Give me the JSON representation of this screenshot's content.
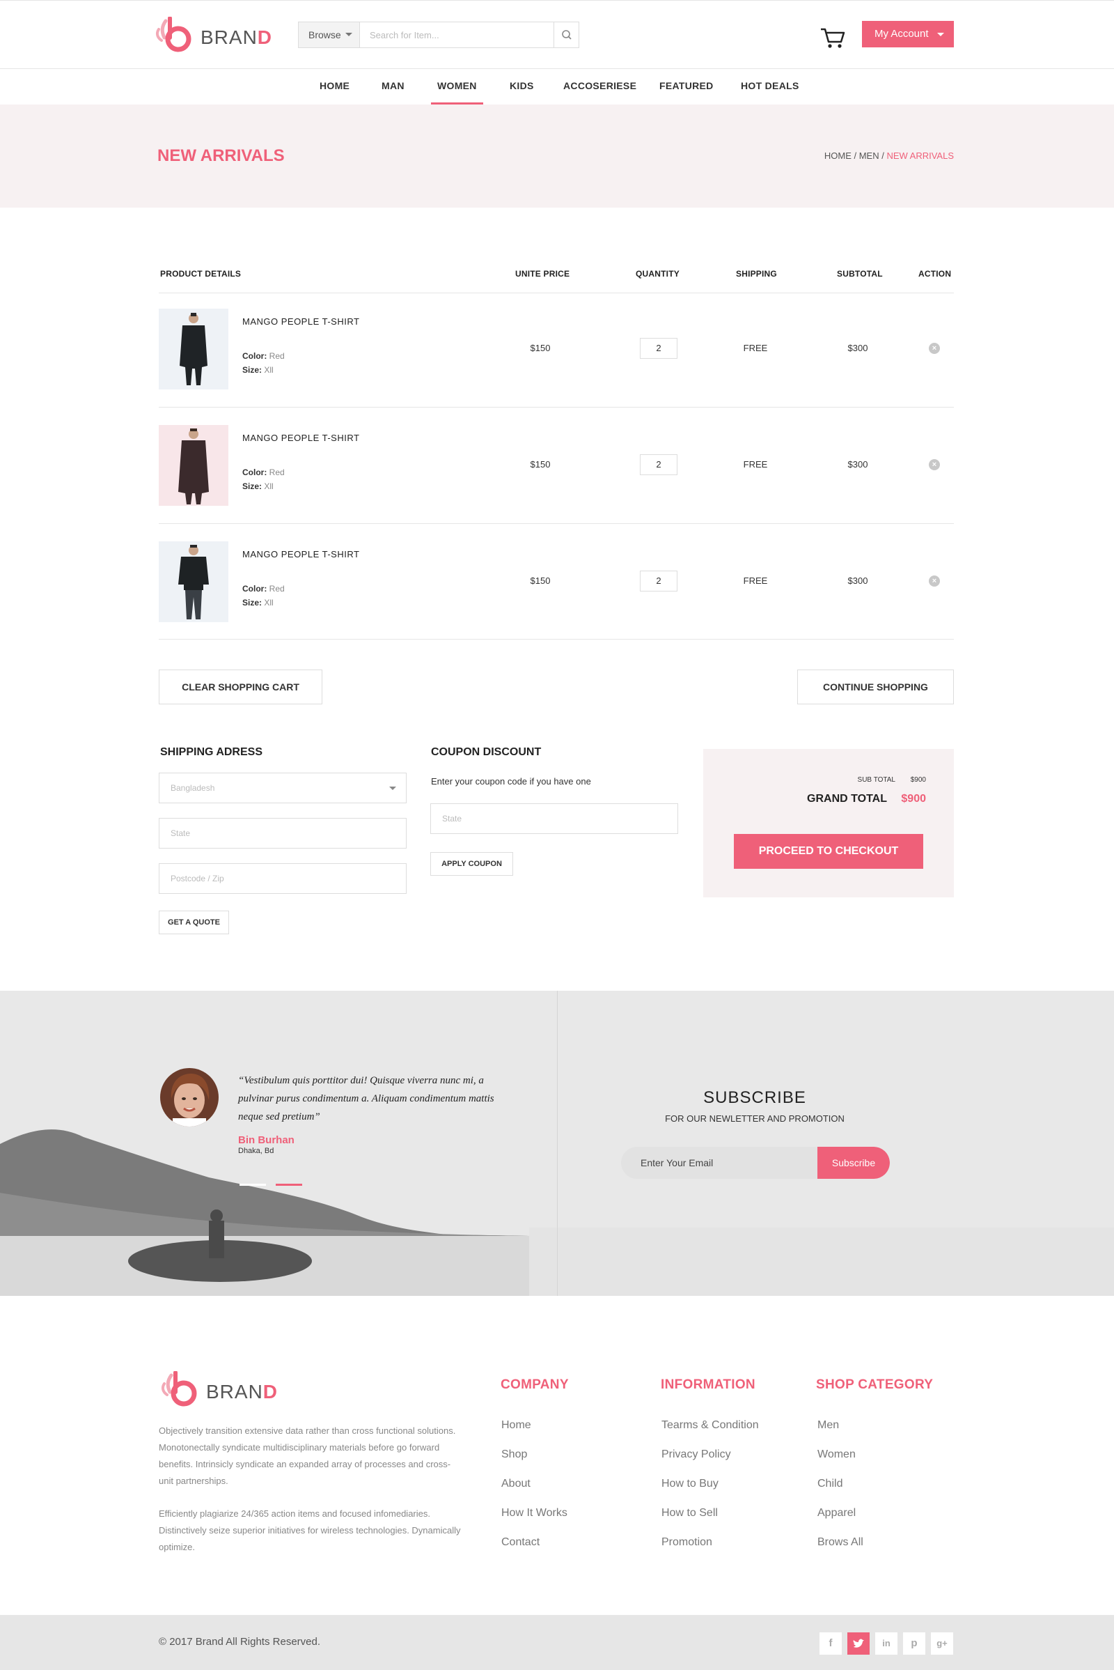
{
  "header": {
    "logo_text": "BRAN",
    "logo_accent": "D",
    "browse_label": "Browse",
    "search_placeholder": "Search for Item...",
    "account_label": "My Account"
  },
  "nav": [
    "HOME",
    "MAN",
    "WOMEN",
    "KIDS",
    "ACCOSERIESE",
    "FEATURED",
    "HOT DEALS"
  ],
  "nav_active": "WOMEN",
  "banner": {
    "title": "NEW ARRIVALS",
    "crumbs": "HOME / MEN / ",
    "crumb_current": "NEW ARRIVALS"
  },
  "cart": {
    "headers": {
      "details": "PRODUCT DETAILS",
      "price": "UNITE PRICE",
      "quantity": "QUANTITY",
      "shipping": "SHIPPING",
      "subtotal": "SUBTOTAL",
      "action": "ACTION"
    },
    "items": [
      {
        "name": "MANGO  PEOPLE  T-SHIRT",
        "color_label": "Color:",
        "color": "Red",
        "size_label": "Size:",
        "size": "Xll",
        "price": "$150",
        "qty": "2",
        "shipping": "FREE",
        "subtotal": "$300"
      },
      {
        "name": "MANGO  PEOPLE  T-SHIRT",
        "color_label": "Color:",
        "color": "Red",
        "size_label": "Size:",
        "size": "Xll",
        "price": "$150",
        "qty": "2",
        "shipping": "FREE",
        "subtotal": "$300"
      },
      {
        "name": "MANGO  PEOPLE  T-SHIRT",
        "color_label": "Color:",
        "color": "Red",
        "size_label": "Size:",
        "size": "Xll",
        "price": "$150",
        "qty": "2",
        "shipping": "FREE",
        "subtotal": "$300"
      }
    ],
    "clear_label": "CLEAR SHOPPING CART",
    "continue_label": "CONTINUE SHOPPING"
  },
  "shipping": {
    "title": "SHIPPING ADRESS",
    "country": "Bangladesh",
    "state_placeholder": "State",
    "zip_placeholder": "Postcode / Zip",
    "quote_label": "GET A QUOTE"
  },
  "coupon": {
    "title": "COUPON  DISCOUNT",
    "hint": "Enter your coupon code if you have one",
    "placeholder": "State",
    "apply_label": "APPLY COUPON"
  },
  "totals": {
    "sub_label": "SUB TOTAL",
    "sub_value": "$900",
    "grand_label": "GRAND TOTAL",
    "grand_value": "$900",
    "checkout_label": "PROCEED TO CHECKOUT"
  },
  "testimonial": {
    "quote": "“Vestibulum quis porttitor dui! Quisque viverra nunc mi, a pulvinar purus condimentum a. Aliquam condimentum mattis neque sed pretium”",
    "name": "Bin Burhan",
    "location": "Dhaka, Bd"
  },
  "subscribe": {
    "title": "SUBSCRIBE",
    "subtitle": "FOR OUR NEWLETTER AND PROMOTION",
    "placeholder": "Enter Your Email",
    "button": "Subscribe"
  },
  "footer": {
    "logo_text": "BRAN",
    "logo_accent": "D",
    "desc1": "Objectively transition extensive data rather than cross functional solutions. Monotonectally syndicate multidisciplinary materials before go forward benefits. Intrinsicly syndicate an expanded array of processes and cross-unit partnerships.",
    "desc2": "Efficiently plagiarize 24/365 action items and focused infomediaries. Distinctively seize superior initiatives for wireless technologies. Dynamically optimize.",
    "company": {
      "title": "COMPANY",
      "links": [
        "Home",
        "Shop",
        "About",
        "How It Works",
        "Contact"
      ]
    },
    "information": {
      "title": "INFORMATION",
      "links": [
        "Tearms & Condition",
        "Privacy Policy",
        "How to Buy",
        "How to Sell",
        "Promotion"
      ]
    },
    "shop": {
      "title": "SHOP CATEGORY",
      "links": [
        "Men",
        "Women",
        "Child",
        "Apparel",
        "Brows All"
      ]
    },
    "copyright": "© 2017  Brand  All Rights Reserved.",
    "social": [
      "facebook-icon",
      "twitter-icon",
      "linkedin-icon",
      "pinterest-icon",
      "google-plus-icon"
    ]
  },
  "colors": {
    "accent": "#ef6079",
    "banner_bg": "#f7f1f2",
    "bottom_bar": "#e6e6e6"
  }
}
